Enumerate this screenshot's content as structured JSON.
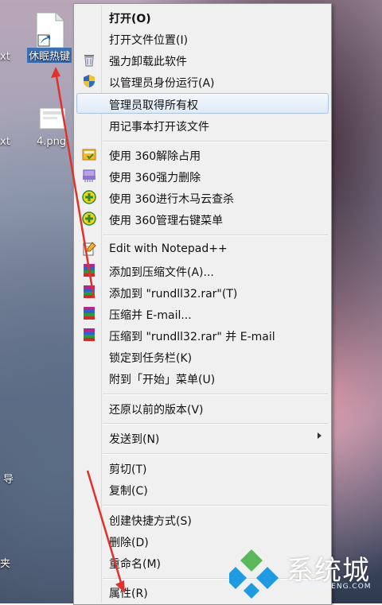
{
  "desktop": {
    "icon1_label": "休眠热键",
    "icon2_label": "4.png",
    "left_frag1": "xt",
    "left_frag2": "xt",
    "left_frag3": "导",
    "left_frag4": "夹"
  },
  "menu": {
    "items": [
      {
        "label": "打开(O)",
        "bold": true
      },
      {
        "label": "打开文件位置(I)"
      },
      {
        "label": "强力卸载此软件",
        "icon": "trash-icon"
      },
      {
        "label": "以管理员身份运行(A)",
        "icon": "shield-icon"
      },
      {
        "label": "管理员取得所有权"
      },
      {
        "label": "用记事本打开该文件"
      },
      {
        "label": "使用 360解除占用",
        "icon": "unlock-360-icon"
      },
      {
        "label": "使用 360强力删除",
        "icon": "shred-360-icon"
      },
      {
        "label": "使用 360进行木马云查杀",
        "icon": "scan-360-icon"
      },
      {
        "label": "使用 360管理右键菜单",
        "icon": "menu-360-icon"
      },
      {
        "label": "Edit with Notepad++",
        "icon": "notepad-plus-icon"
      },
      {
        "label": "添加到压缩文件(A)...",
        "icon": "winrar-icon"
      },
      {
        "label": "添加到 \"rundll32.rar\"(T)",
        "icon": "winrar-icon"
      },
      {
        "label": "压缩并 E-mail...",
        "icon": "winrar-icon"
      },
      {
        "label": "压缩到 \"rundll32.rar\" 并 E-mail",
        "icon": "winrar-icon"
      },
      {
        "label": "锁定到任务栏(K)"
      },
      {
        "label": "附到「开始」菜单(U)"
      },
      {
        "label": "还原以前的版本(V)"
      },
      {
        "label": "发送到(N)",
        "submenu": true
      },
      {
        "label": "剪切(T)"
      },
      {
        "label": "复制(C)"
      },
      {
        "label": "创建快捷方式(S)"
      },
      {
        "label": "删除(D)"
      },
      {
        "label": "重命名(M)"
      },
      {
        "label": "属性(R)"
      }
    ]
  },
  "watermark": {
    "title": "系统城",
    "subtitle": "XITONGCHENG.COM"
  },
  "colors": {
    "menu_bg": "#f0f0f0",
    "hover_border": "#a8c3e4",
    "arrow_red": "#e0312b",
    "logo_blue": "#1e9be0",
    "logo_green": "#5bb85a"
  }
}
